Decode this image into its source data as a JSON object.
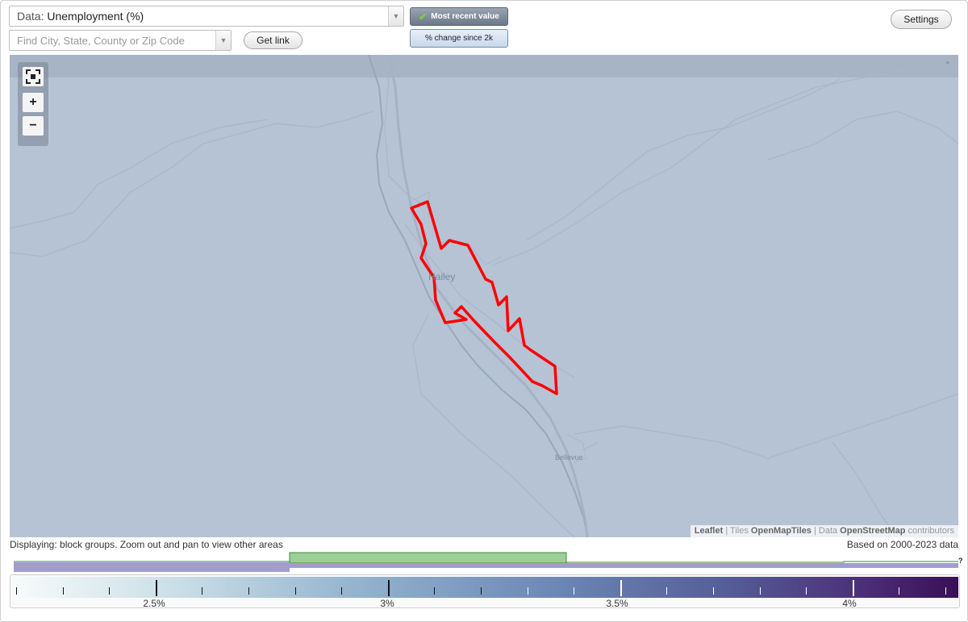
{
  "controls": {
    "data_prefix": "Data:",
    "data_value": "Unemployment (%)",
    "search_placeholder": "Find City, State, County or Zip Code",
    "get_link_label": "Get link",
    "settings_label": "Settings",
    "mode_recent_label": "Most recent value",
    "mode_change_label": "% change since 2k"
  },
  "map": {
    "places": [
      {
        "name": "Hailey"
      },
      {
        "name": "Bellevue"
      }
    ],
    "highlight_color": "#ff0000",
    "attribution": {
      "leaflet": "Leaflet",
      "sep1": " | Tiles ",
      "tiles": "OpenMapTiles",
      "sep2": " | Data ",
      "data": "OpenStreetMap",
      "tail": " contributors"
    }
  },
  "footer": {
    "status": "Displaying: block groups. Zoom out and pan to view other areas",
    "based_on": "Based on 2000-2023 data",
    "help_mark": "?"
  },
  "legend": {
    "labels": [
      "2.5%",
      "3%",
      "3.5%",
      "4%"
    ],
    "histogram_color": "#9ccf97",
    "highlight_color": "#a39dcf"
  }
}
